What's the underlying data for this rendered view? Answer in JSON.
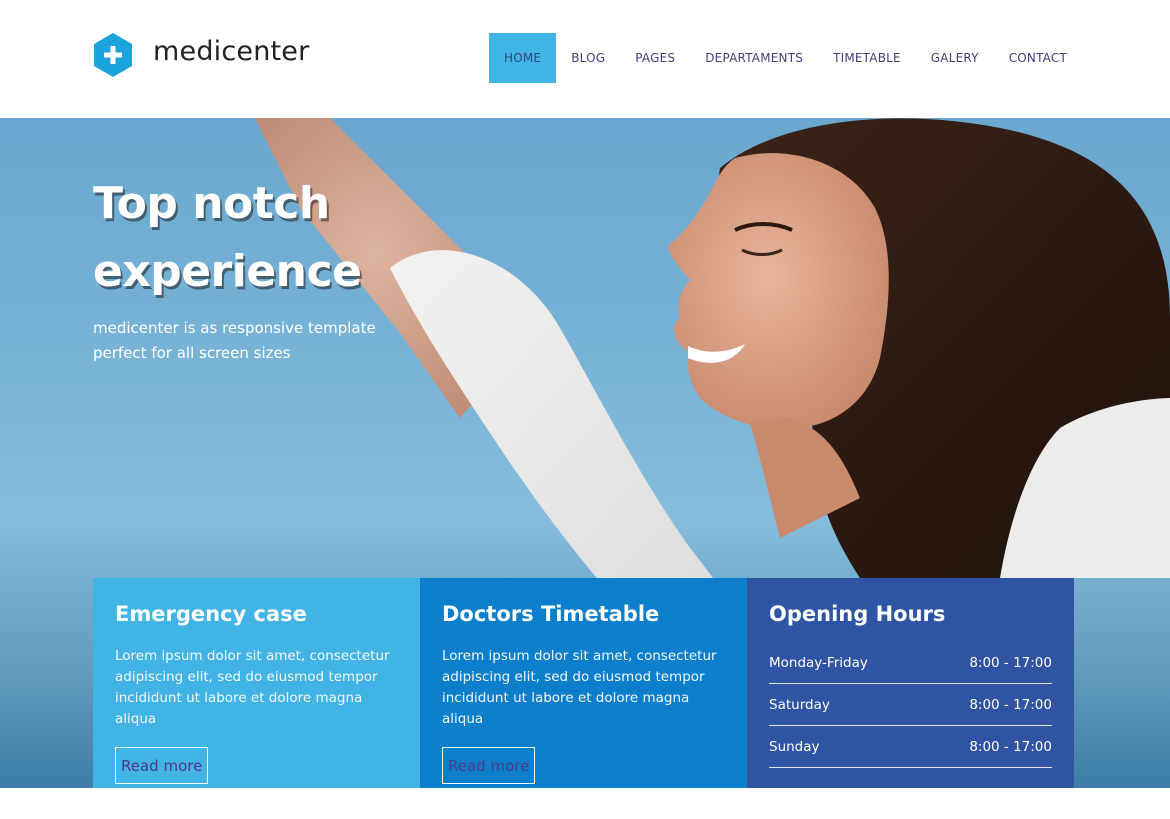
{
  "brand": {
    "name": "medicenter",
    "accent": "#42b3e5",
    "logo_icon": "plus-hexagon-icon"
  },
  "nav": {
    "items": [
      {
        "label": "HOME",
        "active": true
      },
      {
        "label": "BLOG",
        "active": false
      },
      {
        "label": "PAGES",
        "active": false
      },
      {
        "label": "DEPARTAMENTS",
        "active": false
      },
      {
        "label": "TIMETABLE",
        "active": false
      },
      {
        "label": "GALERY",
        "active": false
      },
      {
        "label": "CONTACT",
        "active": false
      }
    ]
  },
  "hero": {
    "title_line1": "Top notch",
    "title_line2": "experience",
    "subtitle_line1": "medicenter is as responsive template",
    "subtitle_line2": "perfect for all screen sizes"
  },
  "boxes": {
    "emergency": {
      "title": "Emergency case",
      "text": "Lorem ipsum dolor sit amet, consectetur adipiscing elit, sed do eiusmod tempor incididunt ut labore et dolore magna aliqua",
      "button": "Read more",
      "color": "#42b3e5"
    },
    "timetable": {
      "title": "Doctors Timetable",
      "text": "Lorem ipsum dolor sit amet, consectetur adipiscing elit, sed do eiusmod tempor incididunt ut labore et dolore magna aliqua",
      "button": "Read more",
      "color": "#0b7fcb"
    },
    "hours": {
      "title": "Opening Hours",
      "color": "#2f54a3",
      "rows": [
        {
          "day": "Monday-Friday",
          "time": "8:00 - 17:00"
        },
        {
          "day": "Saturday",
          "time": "8:00 - 17:00"
        },
        {
          "day": "Sunday",
          "time": "8:00 - 17:00"
        }
      ]
    }
  }
}
